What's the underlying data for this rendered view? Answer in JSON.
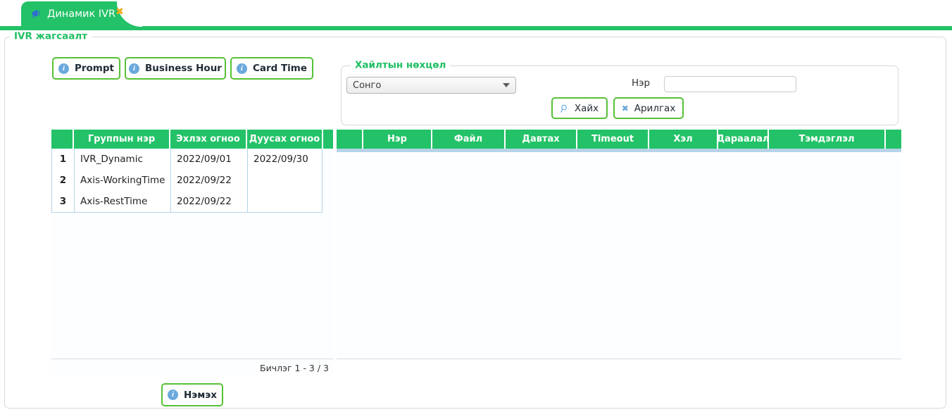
{
  "tab": {
    "label": "Динамик IVR",
    "icon": "megaphone-icon",
    "close": "✖"
  },
  "page": {
    "legend": "IVR жагсаалт"
  },
  "toolbar": {
    "buttons": [
      {
        "label": "Prompt",
        "icon": "info-icon"
      },
      {
        "label": "Business Hour",
        "icon": "info-icon"
      },
      {
        "label": "Card Time",
        "icon": "info-icon"
      }
    ]
  },
  "search": {
    "legend": "Хайлтын нөхцөл",
    "select_value": "Сонго",
    "name_label": "Нэр",
    "name_value": "",
    "name_placeholder": "",
    "search_button": "Хайх",
    "clear_button": "Арилгах"
  },
  "left_grid": {
    "columns": [
      "",
      "Группын нэр",
      "Эхлэх огноо",
      "Дуусах огноо",
      ""
    ],
    "rows": [
      {
        "index": "1",
        "group_name": "IVR_Dynamic",
        "start_date": "2022/09/01",
        "end_date": "2022/09/30"
      },
      {
        "index": "2",
        "group_name": "Axis-WorkingTime",
        "start_date": "2022/09/22",
        "end_date": ""
      },
      {
        "index": "3",
        "group_name": "Axis-RestTime",
        "start_date": "2022/09/22",
        "end_date": ""
      }
    ],
    "footer": "Бичлэг 1 - 3 / 3"
  },
  "right_grid": {
    "columns": [
      "",
      "Нэр",
      "Файл",
      "Давтах",
      "Timeout",
      "Хэл",
      "Дараалал",
      "Тэмдэглэл",
      ""
    ],
    "rows": []
  },
  "footer": {
    "add_button": "Нэмэх",
    "add_icon": "info-icon"
  },
  "colors": {
    "green": "#23c268",
    "green_border": "#56c136",
    "legend_green": "#1fbf63",
    "info_blue": "#6aa9dd",
    "close_orange": "#f0a818",
    "grid_border": "#b6d4e8"
  }
}
